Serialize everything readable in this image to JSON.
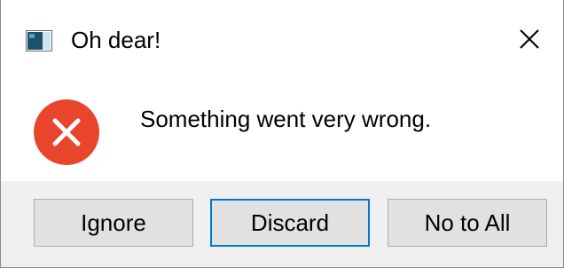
{
  "window": {
    "title": "Oh dear!",
    "app_icon": "application-window-icon",
    "close_icon": "close-icon"
  },
  "dialog": {
    "icon": "error-icon",
    "message": "Something went very wrong."
  },
  "buttons": {
    "ignore_label": "Ignore",
    "discard_label": "Discard",
    "no_to_all_label": "No to All"
  },
  "colors": {
    "error_red": "#e74c3c",
    "default_button_border": "#0078d7",
    "button_bar_bg": "#f0f0f0",
    "button_bg": "#e1e1e1"
  }
}
